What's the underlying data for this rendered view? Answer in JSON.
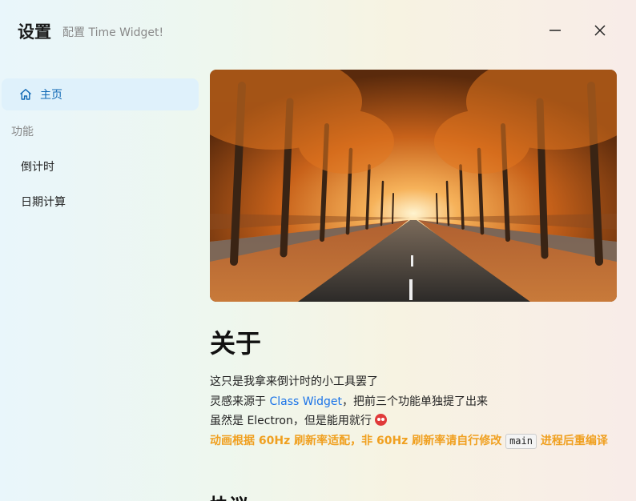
{
  "window": {
    "title": "设置",
    "subtitle": "配置 Time Widget!",
    "minimize_icon": "minimize-icon",
    "close_icon": "close-icon"
  },
  "sidebar": {
    "home": {
      "label": "主页",
      "icon": "home-icon"
    },
    "section_label": "功能",
    "items": [
      {
        "label": "倒计时"
      },
      {
        "label": "日期计算"
      }
    ]
  },
  "main": {
    "hero_image": "autumn tree-lined avenue illustration",
    "about_title": "关于",
    "lines": {
      "line1": "这只是我拿来倒计时的小工具罢了",
      "line2_prefix": "灵感来源于 ",
      "line2_link": "Class Widget",
      "line2_suffix": "，把前三个功能单独提了出来",
      "line3_text": "虽然是 Electron，但是能用就行",
      "line3_emoji": "angry-face-emoji",
      "warn_prefix": "动画根据 60Hz 刷新率适配，非 60Hz 刷新率请自行修改",
      "warn_code": "main",
      "warn_suffix": "进程后重编译"
    },
    "next_heading": "协议"
  },
  "colors": {
    "accent": "#1169b5",
    "link": "#1a73e8",
    "warning": "#f0a020",
    "home_highlight": "#dff1fb"
  }
}
